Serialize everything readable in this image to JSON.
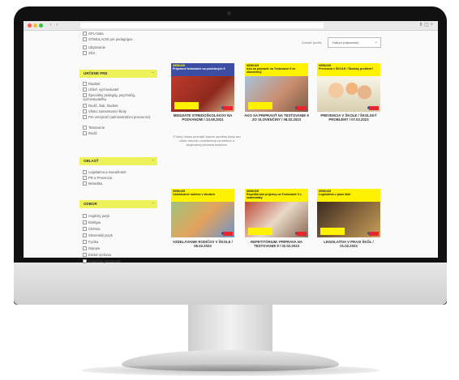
{
  "browser": {
    "nav_back": "‹",
    "nav_forward": "›",
    "icons": "⬆ ◫ +"
  },
  "sidebar": {
    "top_items": [
      "SPU Nitra",
      "STIMULACNÍ pre pedagógov",
      "Ubytovanie",
      "ZŠS"
    ],
    "groups": [
      {
        "title": "URČENÉ PRE",
        "toggle": "–",
        "items": [
          "Riaditeľ",
          "Učiteľ, vychovávateľ",
          "Špeciálny pedagóg, psychológ, vychovávateľka",
          "Rodič, žiak, študent",
          "Všetci zamestnanci školy",
          "Pre verejnosť (administratívni pracovníci)",
          "Testovanie",
          "Rodič"
        ]
      },
      {
        "title": "OBLASŤ",
        "toggle": "–",
        "items": [
          "Legislatíva a manažment",
          "PR a Prevencia",
          "Metodika"
        ]
      },
      {
        "title": "ODBOR",
        "toggle": "–",
        "items": [
          "Anglický jazyk",
          "Biológia",
          "Chémia",
          "Slovenský jazyk",
          "Fyzika",
          "Dejepis",
          "Etická výchova",
          "Finančná gramotnosť",
          "Geografia",
          "Informatika"
        ]
      }
    ]
  },
  "sort": {
    "label": "Zoradiť podľa:",
    "value": "Dátum (najnovšie)",
    "chevron": "⌄"
  },
  "cards": [
    {
      "tag": "WEBINÁR",
      "title_top": "Prípravné testovanie na posledných 9",
      "title": "MEDZIATE STREDOŠKOLÁKOV NA PODVANOMI / 24.08.2021"
    },
    {
      "tag": "WEBINÁR",
      "title_top": "Ako sa pripraviť na Testovanie 9 zo slovenčiny",
      "title": "AKO SA PRIPRAVIŤ NA TESTOVANIE 9 ZO SLOVENČINY / 08.02.2023"
    },
    {
      "tag": "WEBINÁR",
      "title_top": "Prevencia v ŠKOLE / Školský problém?",
      "title": "PREVENCIA V ŠKOLE / ŠKOLSKÝ PROBLÉM? / 07.02.2023"
    },
    {
      "tag": "WEBINÁR",
      "title_top": "Vzdelávanie rodičov v školách",
      "title": "VZDELÁVANIE RODIČOV V ŠKOLE / 06.02.2023"
    },
    {
      "tag": "WEBINÁR",
      "title_top": "Repetitórium prípravy na Testovanie 9 z matematiky",
      "title": "REPETITÓRIUM: PRÍPRAVA NA TESTOVANIE 9 / 02.02.2023"
    },
    {
      "tag": "WEBINÁR",
      "title_top": "Legislatíva v praxi škôl",
      "title": "LEGISLATÍVA V PRAXI ŠKÔL / 01.02.2023"
    }
  ],
  "promo_text": "O ktorý obsah prísnejší žiakom strednej školy ako vôbec nemôžu vzdelávania sa stretnúť a zaujímavej pozvania budúcna.",
  "colors": {
    "accent": "#eef25a",
    "brand_red": "#e8262d",
    "brand_blue": "#2b4aa8"
  }
}
